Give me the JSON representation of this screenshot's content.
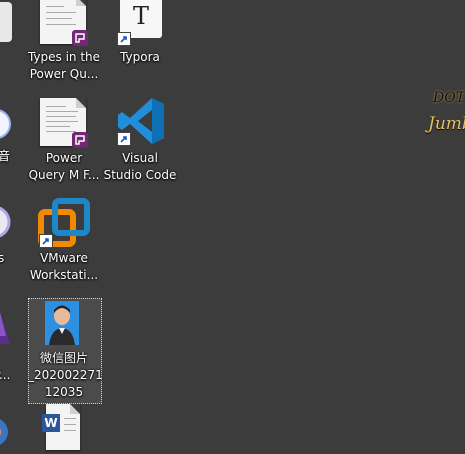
{
  "desktop": {
    "background_color": "#3c3c3c",
    "partial_left_column": {
      "labels": [
        "音",
        "s",
        "­",
        "nP..."
      ]
    },
    "icons": [
      {
        "id": "types",
        "label_lines": [
          "Types in the",
          "Power Qu..."
        ]
      },
      {
        "id": "typora",
        "label_lines": [
          "Typora"
        ]
      },
      {
        "id": "pqm",
        "label_lines": [
          "Power",
          "Query M F..."
        ]
      },
      {
        "id": "vscode",
        "label_lines": [
          "Visual",
          "Studio Code"
        ]
      },
      {
        "id": "vmware",
        "label_lines": [
          "VMware",
          "Workstati..."
        ]
      },
      {
        "id": "wechat_img",
        "label_lines": [
          "微信图片",
          "_202002271",
          "12035"
        ]
      },
      {
        "id": "word_doc",
        "label_lines": []
      }
    ],
    "typora_glyph": "T",
    "word_glyph": "W",
    "edge_text": {
      "top": "DOT",
      "bottom": "Jumbo"
    }
  },
  "colors": {
    "vscode_blue": "#1e8fd8",
    "vmware_orange": "#f18a00",
    "vmware_blue": "#1e88c7",
    "pq_purple": "#742774",
    "word_blue": "#2b579a"
  }
}
